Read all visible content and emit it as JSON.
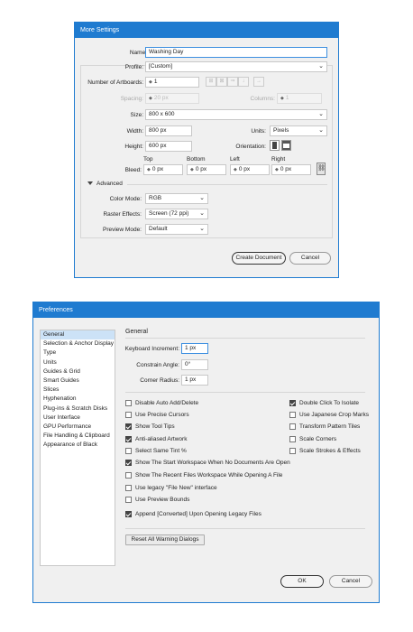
{
  "more_settings": {
    "title": "More Settings",
    "name_label": "Name:",
    "name_value": "Washing Day",
    "profile_label": "Profile:",
    "profile_value": "[Custom]",
    "artboards_label": "Number of Artboards:",
    "artboards_value": "1",
    "spacing_label": "Spacing:",
    "spacing_value": "20 px",
    "columns_label": "Columns:",
    "columns_value": "1",
    "size_label": "Size:",
    "size_value": "800 x 600",
    "width_label": "Width:",
    "width_value": "800 px",
    "units_label": "Units:",
    "units_value": "Pixels",
    "height_label": "Height:",
    "height_value": "600 px",
    "orientation_label": "Orientation:",
    "bleed_label": "Bleed:",
    "bleed_top_label": "Top",
    "bleed_top_value": "0 px",
    "bleed_bottom_label": "Bottom",
    "bleed_bottom_value": "0 px",
    "bleed_left_label": "Left",
    "bleed_left_value": "0 px",
    "bleed_right_label": "Right",
    "bleed_right_value": "0 px",
    "advanced_label": "Advanced",
    "color_mode_label": "Color Mode:",
    "color_mode_value": "RGB",
    "raster_effects_label": "Raster Effects:",
    "raster_effects_value": "Screen (72 ppi)",
    "preview_mode_label": "Preview Mode:",
    "preview_mode_value": "Default",
    "create_button": "Create Document",
    "cancel_button": "Cancel"
  },
  "preferences": {
    "title": "Preferences",
    "categories": [
      "General",
      "Selection & Anchor Display",
      "Type",
      "Units",
      "Guides & Grid",
      "Smart Guides",
      "Slices",
      "Hyphenation",
      "Plug-ins & Scratch Disks",
      "User Interface",
      "GPU Performance",
      "File Handling & Clipboard",
      "Appearance of Black"
    ],
    "section_title": "General",
    "keyboard_increment_label": "Keyboard Increment:",
    "keyboard_increment_value": "1 px",
    "constrain_angle_label": "Constrain Angle:",
    "constrain_angle_value": "0°",
    "corner_radius_label": "Corner Radius:",
    "corner_radius_value": "1 px",
    "checkboxes_left": [
      {
        "label": "Disable Auto Add/Delete",
        "checked": false
      },
      {
        "label": "Use Precise Cursors",
        "checked": false
      },
      {
        "label": "Show Tool Tips",
        "checked": true
      },
      {
        "label": "Anti-aliased Artwork",
        "checked": true
      },
      {
        "label": "Select Same Tint %",
        "checked": false
      },
      {
        "label": "Show The Start Workspace When No Documents Are Open",
        "checked": true
      },
      {
        "label": "Show The Recent Files Workspace While Opening A File",
        "checked": false
      },
      {
        "label": "Use legacy \"File New\" interface",
        "checked": false
      },
      {
        "label": "Use Preview Bounds",
        "checked": false
      },
      {
        "label": "Append [Converted] Upon Opening Legacy Files",
        "checked": true
      }
    ],
    "checkboxes_right": [
      {
        "label": "Double Click To Isolate",
        "checked": true
      },
      {
        "label": "Use Japanese Crop Marks",
        "checked": false
      },
      {
        "label": "Transform Pattern Tiles",
        "checked": false
      },
      {
        "label": "Scale Corners",
        "checked": false
      },
      {
        "label": "Scale Strokes & Effects",
        "checked": false
      }
    ],
    "reset_button": "Reset All Warning Dialogs",
    "ok_button": "OK",
    "cancel_button": "Cancel"
  },
  "colors": {
    "titlebar": "#1f7bd0",
    "dialog_bg": "#f0f0f0",
    "selection": "#cce2f7"
  }
}
